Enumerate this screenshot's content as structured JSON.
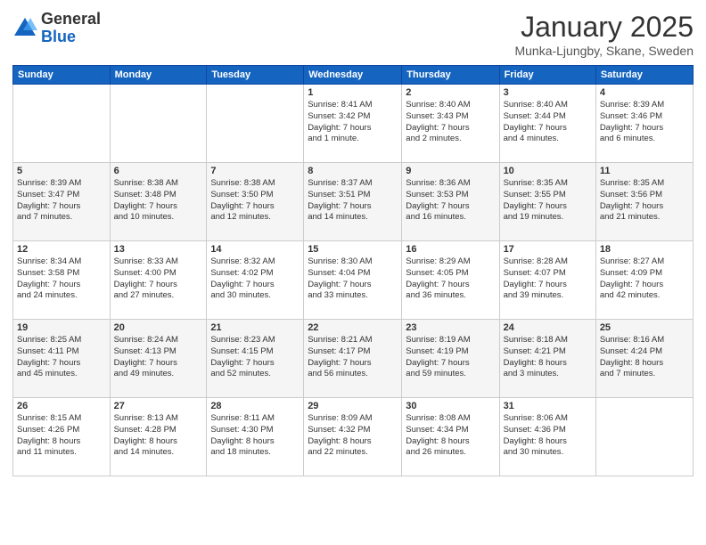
{
  "header": {
    "logo_general": "General",
    "logo_blue": "Blue",
    "title": "January 2025",
    "location": "Munka-Ljungby, Skane, Sweden"
  },
  "weekdays": [
    "Sunday",
    "Monday",
    "Tuesday",
    "Wednesday",
    "Thursday",
    "Friday",
    "Saturday"
  ],
  "weeks": [
    [
      {
        "day": "",
        "info": ""
      },
      {
        "day": "",
        "info": ""
      },
      {
        "day": "",
        "info": ""
      },
      {
        "day": "1",
        "info": "Sunrise: 8:41 AM\nSunset: 3:42 PM\nDaylight: 7 hours\nand 1 minute."
      },
      {
        "day": "2",
        "info": "Sunrise: 8:40 AM\nSunset: 3:43 PM\nDaylight: 7 hours\nand 2 minutes."
      },
      {
        "day": "3",
        "info": "Sunrise: 8:40 AM\nSunset: 3:44 PM\nDaylight: 7 hours\nand 4 minutes."
      },
      {
        "day": "4",
        "info": "Sunrise: 8:39 AM\nSunset: 3:46 PM\nDaylight: 7 hours\nand 6 minutes."
      }
    ],
    [
      {
        "day": "5",
        "info": "Sunrise: 8:39 AM\nSunset: 3:47 PM\nDaylight: 7 hours\nand 7 minutes."
      },
      {
        "day": "6",
        "info": "Sunrise: 8:38 AM\nSunset: 3:48 PM\nDaylight: 7 hours\nand 10 minutes."
      },
      {
        "day": "7",
        "info": "Sunrise: 8:38 AM\nSunset: 3:50 PM\nDaylight: 7 hours\nand 12 minutes."
      },
      {
        "day": "8",
        "info": "Sunrise: 8:37 AM\nSunset: 3:51 PM\nDaylight: 7 hours\nand 14 minutes."
      },
      {
        "day": "9",
        "info": "Sunrise: 8:36 AM\nSunset: 3:53 PM\nDaylight: 7 hours\nand 16 minutes."
      },
      {
        "day": "10",
        "info": "Sunrise: 8:35 AM\nSunset: 3:55 PM\nDaylight: 7 hours\nand 19 minutes."
      },
      {
        "day": "11",
        "info": "Sunrise: 8:35 AM\nSunset: 3:56 PM\nDaylight: 7 hours\nand 21 minutes."
      }
    ],
    [
      {
        "day": "12",
        "info": "Sunrise: 8:34 AM\nSunset: 3:58 PM\nDaylight: 7 hours\nand 24 minutes."
      },
      {
        "day": "13",
        "info": "Sunrise: 8:33 AM\nSunset: 4:00 PM\nDaylight: 7 hours\nand 27 minutes."
      },
      {
        "day": "14",
        "info": "Sunrise: 8:32 AM\nSunset: 4:02 PM\nDaylight: 7 hours\nand 30 minutes."
      },
      {
        "day": "15",
        "info": "Sunrise: 8:30 AM\nSunset: 4:04 PM\nDaylight: 7 hours\nand 33 minutes."
      },
      {
        "day": "16",
        "info": "Sunrise: 8:29 AM\nSunset: 4:05 PM\nDaylight: 7 hours\nand 36 minutes."
      },
      {
        "day": "17",
        "info": "Sunrise: 8:28 AM\nSunset: 4:07 PM\nDaylight: 7 hours\nand 39 minutes."
      },
      {
        "day": "18",
        "info": "Sunrise: 8:27 AM\nSunset: 4:09 PM\nDaylight: 7 hours\nand 42 minutes."
      }
    ],
    [
      {
        "day": "19",
        "info": "Sunrise: 8:25 AM\nSunset: 4:11 PM\nDaylight: 7 hours\nand 45 minutes."
      },
      {
        "day": "20",
        "info": "Sunrise: 8:24 AM\nSunset: 4:13 PM\nDaylight: 7 hours\nand 49 minutes."
      },
      {
        "day": "21",
        "info": "Sunrise: 8:23 AM\nSunset: 4:15 PM\nDaylight: 7 hours\nand 52 minutes."
      },
      {
        "day": "22",
        "info": "Sunrise: 8:21 AM\nSunset: 4:17 PM\nDaylight: 7 hours\nand 56 minutes."
      },
      {
        "day": "23",
        "info": "Sunrise: 8:19 AM\nSunset: 4:19 PM\nDaylight: 7 hours\nand 59 minutes."
      },
      {
        "day": "24",
        "info": "Sunrise: 8:18 AM\nSunset: 4:21 PM\nDaylight: 8 hours\nand 3 minutes."
      },
      {
        "day": "25",
        "info": "Sunrise: 8:16 AM\nSunset: 4:24 PM\nDaylight: 8 hours\nand 7 minutes."
      }
    ],
    [
      {
        "day": "26",
        "info": "Sunrise: 8:15 AM\nSunset: 4:26 PM\nDaylight: 8 hours\nand 11 minutes."
      },
      {
        "day": "27",
        "info": "Sunrise: 8:13 AM\nSunset: 4:28 PM\nDaylight: 8 hours\nand 14 minutes."
      },
      {
        "day": "28",
        "info": "Sunrise: 8:11 AM\nSunset: 4:30 PM\nDaylight: 8 hours\nand 18 minutes."
      },
      {
        "day": "29",
        "info": "Sunrise: 8:09 AM\nSunset: 4:32 PM\nDaylight: 8 hours\nand 22 minutes."
      },
      {
        "day": "30",
        "info": "Sunrise: 8:08 AM\nSunset: 4:34 PM\nDaylight: 8 hours\nand 26 minutes."
      },
      {
        "day": "31",
        "info": "Sunrise: 8:06 AM\nSunset: 4:36 PM\nDaylight: 8 hours\nand 30 minutes."
      },
      {
        "day": "",
        "info": ""
      }
    ]
  ]
}
